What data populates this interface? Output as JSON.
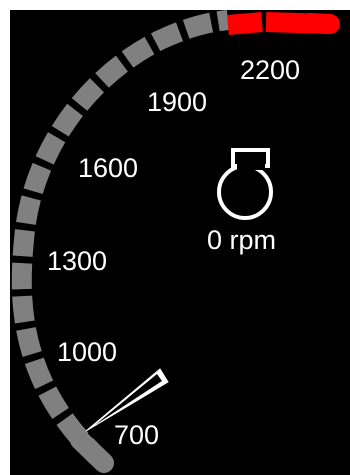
{
  "gauge": {
    "unit": "rpm",
    "current_value": 0,
    "readout_text": "0 rpm",
    "tick_labels": [
      "700",
      "1000",
      "1300",
      "1600",
      "1900",
      "2200"
    ],
    "icon": "engine-icon",
    "colors": {
      "background": "#000000",
      "normal_segment": "#808080",
      "redline_segment": "#ff0000",
      "needle": "#ffffff",
      "text": "#ffffff"
    }
  }
}
